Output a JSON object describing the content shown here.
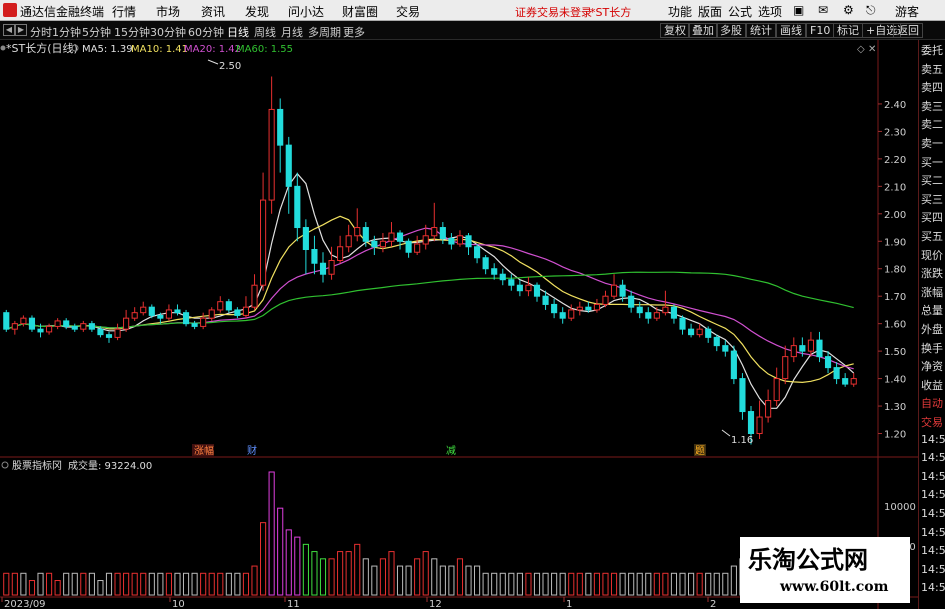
{
  "menubar": {
    "app_title": "通达信金融终端",
    "items": [
      "行情",
      "市场",
      "资讯",
      "发现",
      "问小达",
      "财富圈",
      "交易"
    ],
    "notice": "证券交易未登录",
    "stock_tag": "*ST长方",
    "right_items": [
      "功能",
      "版面",
      "公式",
      "选项"
    ],
    "guest": "游客"
  },
  "periodbar": {
    "periods": [
      "分时",
      "1分钟",
      "5分钟",
      "15分钟",
      "30分钟",
      "60分钟",
      "日线",
      "周线",
      "月线",
      "多周期",
      "更多"
    ],
    "active": "日线",
    "tools": [
      "复权",
      "叠加",
      "多股",
      "统计",
      "画线",
      "F10",
      "标记",
      "+自选",
      "返回"
    ]
  },
  "indicator_line": {
    "name": "*ST长方(日线)",
    "ma5": "MA5: 1.39",
    "ma10": "MA10: 1.41",
    "ma20": "MA20: 1.42",
    "ma60": "MA60: 1.55"
  },
  "annotations": {
    "high_label": "2.50",
    "low_label": "1.16",
    "event_markers": [
      "涨幅",
      "财",
      "减",
      "题"
    ]
  },
  "volume_panel": {
    "title": "股票指标冈",
    "volume_label": "成交量: 93224.00",
    "axis_label": "10000",
    "axis_label_2": "00"
  },
  "colors": {
    "up": "#e83030",
    "down": "#22dcdc",
    "ma5": "#e0e0e0",
    "ma10": "#f0e060",
    "ma20": "#d050d0",
    "ma60": "#30c030",
    "vol_magenta": "#e040e0",
    "vol_green": "#40e040",
    "vol_gray": "#bbbbbb"
  },
  "right_panel": {
    "items": [
      "委托",
      "卖五",
      "卖四",
      "卖三",
      "卖二",
      "卖一",
      "买一",
      "买二",
      "买三",
      "买四",
      "买五",
      "现价",
      "涨跌",
      "涨幅",
      "总量",
      "外盘",
      "换手",
      "净资",
      "收益",
      "自动",
      "交易",
      "14:53",
      "14:54",
      "14:54",
      "14:54",
      "14:54",
      "14:54",
      "14:54",
      "14:54",
      "14:55"
    ]
  },
  "watermark": {
    "title": "乐淘公式网",
    "url": "www.60lt.com"
  },
  "chart_data": {
    "type": "candlestick",
    "y_ticks": [
      2.4,
      2.3,
      2.2,
      2.1,
      2.0,
      1.9,
      1.8,
      1.7,
      1.6,
      1.5,
      1.4,
      1.3,
      1.2
    ],
    "ylim": [
      1.14,
      2.56
    ],
    "x_tick_labels": [
      "2023/09",
      "10",
      "11",
      "12",
      "1",
      "2"
    ],
    "candles": [
      [
        1.64,
        1.58,
        1.65,
        1.57
      ],
      [
        1.58,
        1.6,
        1.61,
        1.56
      ],
      [
        1.6,
        1.62,
        1.63,
        1.59
      ],
      [
        1.62,
        1.58,
        1.63,
        1.57
      ],
      [
        1.58,
        1.57,
        1.6,
        1.55
      ],
      [
        1.57,
        1.59,
        1.6,
        1.56
      ],
      [
        1.59,
        1.61,
        1.62,
        1.58
      ],
      [
        1.61,
        1.59,
        1.62,
        1.58
      ],
      [
        1.59,
        1.58,
        1.6,
        1.57
      ],
      [
        1.58,
        1.6,
        1.61,
        1.57
      ],
      [
        1.6,
        1.58,
        1.61,
        1.57
      ],
      [
        1.58,
        1.56,
        1.59,
        1.55
      ],
      [
        1.56,
        1.55,
        1.57,
        1.53
      ],
      [
        1.55,
        1.58,
        1.6,
        1.54
      ],
      [
        1.58,
        1.62,
        1.65,
        1.57
      ],
      [
        1.62,
        1.64,
        1.66,
        1.61
      ],
      [
        1.64,
        1.66,
        1.68,
        1.63
      ],
      [
        1.66,
        1.63,
        1.67,
        1.62
      ],
      [
        1.63,
        1.62,
        1.64,
        1.6
      ],
      [
        1.62,
        1.65,
        1.67,
        1.61
      ],
      [
        1.65,
        1.64,
        1.67,
        1.63
      ],
      [
        1.64,
        1.6,
        1.65,
        1.59
      ],
      [
        1.6,
        1.59,
        1.61,
        1.58
      ],
      [
        1.59,
        1.62,
        1.64,
        1.58
      ],
      [
        1.62,
        1.65,
        1.66,
        1.61
      ],
      [
        1.65,
        1.68,
        1.7,
        1.64
      ],
      [
        1.68,
        1.65,
        1.69,
        1.64
      ],
      [
        1.65,
        1.63,
        1.66,
        1.62
      ],
      [
        1.63,
        1.66,
        1.7,
        1.62
      ],
      [
        1.66,
        1.74,
        1.78,
        1.65
      ],
      [
        1.74,
        2.05,
        2.15,
        1.72
      ],
      [
        2.05,
        2.38,
        2.5,
        2.0
      ],
      [
        2.38,
        2.25,
        2.42,
        2.15
      ],
      [
        2.25,
        2.1,
        2.28,
        2.0
      ],
      [
        2.1,
        1.95,
        2.15,
        1.9
      ],
      [
        1.95,
        1.87,
        1.98,
        1.78
      ],
      [
        1.87,
        1.82,
        1.92,
        1.78
      ],
      [
        1.82,
        1.78,
        1.86,
        1.75
      ],
      [
        1.78,
        1.83,
        1.88,
        1.76
      ],
      [
        1.83,
        1.88,
        1.92,
        1.82
      ],
      [
        1.88,
        1.92,
        1.96,
        1.86
      ],
      [
        1.92,
        1.95,
        2.02,
        1.9
      ],
      [
        1.95,
        1.9,
        1.97,
        1.88
      ],
      [
        1.9,
        1.88,
        1.92,
        1.85
      ],
      [
        1.88,
        1.9,
        1.93,
        1.86
      ],
      [
        1.9,
        1.93,
        1.97,
        1.88
      ],
      [
        1.93,
        1.9,
        1.94,
        1.87
      ],
      [
        1.9,
        1.86,
        1.91,
        1.84
      ],
      [
        1.86,
        1.89,
        1.92,
        1.85
      ],
      [
        1.89,
        1.92,
        1.96,
        1.87
      ],
      [
        1.92,
        1.95,
        2.04,
        1.9
      ],
      [
        1.95,
        1.91,
        1.97,
        1.89
      ],
      [
        1.91,
        1.89,
        1.93,
        1.87
      ],
      [
        1.89,
        1.92,
        1.94,
        1.88
      ],
      [
        1.92,
        1.88,
        1.93,
        1.85
      ],
      [
        1.88,
        1.84,
        1.89,
        1.82
      ],
      [
        1.84,
        1.8,
        1.85,
        1.78
      ],
      [
        1.8,
        1.78,
        1.82,
        1.76
      ],
      [
        1.78,
        1.76,
        1.8,
        1.74
      ],
      [
        1.76,
        1.74,
        1.78,
        1.72
      ],
      [
        1.74,
        1.72,
        1.76,
        1.7
      ],
      [
        1.72,
        1.74,
        1.77,
        1.7
      ],
      [
        1.74,
        1.7,
        1.75,
        1.68
      ],
      [
        1.7,
        1.67,
        1.72,
        1.65
      ],
      [
        1.67,
        1.64,
        1.69,
        1.62
      ],
      [
        1.64,
        1.62,
        1.66,
        1.6
      ],
      [
        1.62,
        1.65,
        1.67,
        1.61
      ],
      [
        1.65,
        1.66,
        1.68,
        1.63
      ],
      [
        1.66,
        1.65,
        1.68,
        1.64
      ],
      [
        1.65,
        1.67,
        1.69,
        1.64
      ],
      [
        1.67,
        1.7,
        1.72,
        1.66
      ],
      [
        1.7,
        1.74,
        1.78,
        1.69
      ],
      [
        1.74,
        1.7,
        1.76,
        1.68
      ],
      [
        1.7,
        1.66,
        1.72,
        1.64
      ],
      [
        1.66,
        1.64,
        1.68,
        1.62
      ],
      [
        1.64,
        1.62,
        1.66,
        1.6
      ],
      [
        1.62,
        1.64,
        1.66,
        1.61
      ],
      [
        1.64,
        1.66,
        1.72,
        1.63
      ],
      [
        1.66,
        1.62,
        1.67,
        1.6
      ],
      [
        1.62,
        1.58,
        1.63,
        1.56
      ],
      [
        1.58,
        1.56,
        1.6,
        1.55
      ],
      [
        1.56,
        1.58,
        1.6,
        1.55
      ],
      [
        1.58,
        1.55,
        1.59,
        1.53
      ],
      [
        1.55,
        1.52,
        1.56,
        1.5
      ],
      [
        1.52,
        1.5,
        1.54,
        1.48
      ],
      [
        1.5,
        1.4,
        1.52,
        1.38
      ],
      [
        1.4,
        1.28,
        1.42,
        1.25
      ],
      [
        1.28,
        1.2,
        1.3,
        1.16
      ],
      [
        1.2,
        1.26,
        1.32,
        1.18
      ],
      [
        1.26,
        1.32,
        1.36,
        1.24
      ],
      [
        1.32,
        1.4,
        1.44,
        1.3
      ],
      [
        1.4,
        1.48,
        1.52,
        1.38
      ],
      [
        1.48,
        1.52,
        1.55,
        1.46
      ],
      [
        1.52,
        1.5,
        1.55,
        1.48
      ],
      [
        1.5,
        1.54,
        1.57,
        1.48
      ],
      [
        1.54,
        1.48,
        1.57,
        1.46
      ],
      [
        1.48,
        1.44,
        1.5,
        1.42
      ],
      [
        1.44,
        1.4,
        1.46,
        1.38
      ],
      [
        1.4,
        1.38,
        1.42,
        1.37
      ],
      [
        1.38,
        1.4,
        1.42,
        1.37
      ]
    ],
    "volumes": [
      3,
      3,
      3,
      2,
      3,
      3,
      2,
      3,
      3,
      3,
      3,
      2,
      3,
      3,
      3,
      3,
      3,
      3,
      3,
      3,
      3,
      3,
      3,
      3,
      3,
      3,
      3,
      3,
      3,
      4,
      10,
      17,
      12,
      9,
      8,
      7,
      6,
      5,
      5,
      6,
      6,
      7,
      5,
      4,
      5,
      6,
      4,
      4,
      5,
      6,
      5,
      4,
      4,
      5,
      4,
      4,
      3,
      3,
      3,
      3,
      3,
      3,
      3,
      3,
      3,
      3,
      3,
      3,
      3,
      3,
      3,
      3,
      3,
      3,
      3,
      3,
      3,
      3,
      3,
      3,
      3,
      3,
      3,
      3,
      3,
      4,
      5,
      4,
      4,
      4,
      5,
      4,
      4,
      4,
      4,
      4,
      3,
      3,
      3,
      3
    ],
    "volume_colors": [
      "r",
      "r",
      "g",
      "r",
      "g",
      "r",
      "r",
      "g",
      "g",
      "r",
      "g",
      "g",
      "g",
      "r",
      "r",
      "r",
      "r",
      "g",
      "g",
      "r",
      "g",
      "g",
      "g",
      "r",
      "r",
      "r",
      "g",
      "g",
      "r",
      "r",
      "r",
      "m",
      "m",
      "m",
      "m",
      "v",
      "v",
      "v",
      "r",
      "r",
      "r",
      "r",
      "g",
      "g",
      "r",
      "r",
      "g",
      "g",
      "r",
      "r",
      "g",
      "g",
      "g",
      "r",
      "g",
      "g",
      "g",
      "g",
      "g",
      "g",
      "g",
      "r",
      "g",
      "g",
      "g",
      "g",
      "r",
      "r",
      "g",
      "r",
      "r",
      "r",
      "g",
      "g",
      "g",
      "g",
      "r",
      "r",
      "g",
      "g",
      "g",
      "r",
      "g",
      "g",
      "g",
      "g",
      "g",
      "g",
      "r",
      "r",
      "r",
      "r",
      "r",
      "g",
      "r",
      "g",
      "g",
      "g",
      "g",
      "r"
    ],
    "title": "*ST长方(日线)"
  }
}
